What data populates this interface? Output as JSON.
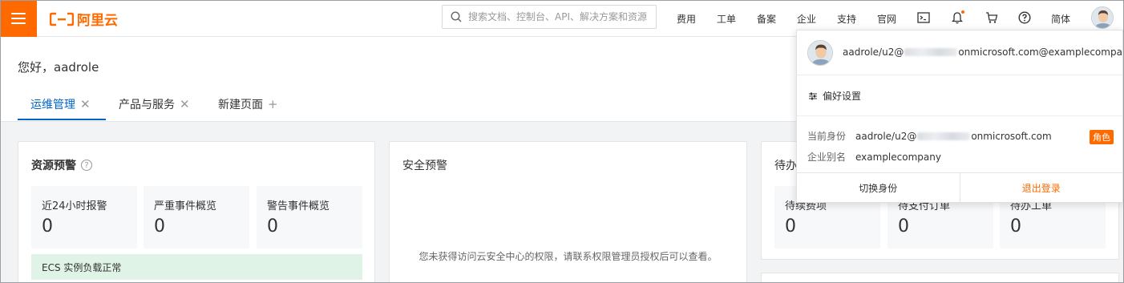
{
  "topbar": {
    "logo_text": "阿里云",
    "search_placeholder": "搜索文档、控制台、API、解决方案和资源",
    "nav": {
      "fees": "费用",
      "ticket": "工单",
      "icp": "备案",
      "enterprise": "企业",
      "support": "支持",
      "website": "官网",
      "language": "简体"
    },
    "icons": [
      "menu-icon",
      "search-icon",
      "terminal-icon",
      "bell-icon",
      "cart-icon",
      "help-icon"
    ],
    "brand_color": "#ff6a00"
  },
  "main": {
    "greeting": "您好，aadrole",
    "tabs": [
      {
        "label": "运维管理",
        "active": true
      },
      {
        "label": "产品与服务",
        "active": false
      },
      {
        "label": "新建页面",
        "active": false
      }
    ],
    "resource_alert": {
      "title": "资源预警",
      "stats": [
        {
          "label": "近24小时报警",
          "value": "0"
        },
        {
          "label": "严重事件概览",
          "value": "0"
        },
        {
          "label": "警告事件概览",
          "value": "0"
        }
      ],
      "ecs_status": "ECS 实例负载正常"
    },
    "security_alert": {
      "title": "安全预警",
      "message": "您未获得访问云安全中心的权限，请联系权限管理员授权后可以查看。"
    },
    "todo": {
      "title_partial": "待办",
      "stats": [
        {
          "label": "待续费项",
          "value": "0"
        },
        {
          "label": "待支付订单",
          "value": "0"
        },
        {
          "label": "待办工单",
          "value": "0"
        }
      ]
    }
  },
  "dropdown": {
    "account_prefix": "aadrole/u2@",
    "account_suffix": "onmicrosoft.com@examplecompany",
    "preferences": "偏好设置",
    "current_identity_label": "当前身份",
    "current_identity_prefix": "aadrole/u2@",
    "current_identity_suffix": "onmicrosoft.com",
    "role_badge": "角色",
    "alias_label": "企业别名",
    "alias_value": "examplecompany",
    "switch_identity": "切换身份",
    "logout": "退出登录"
  }
}
